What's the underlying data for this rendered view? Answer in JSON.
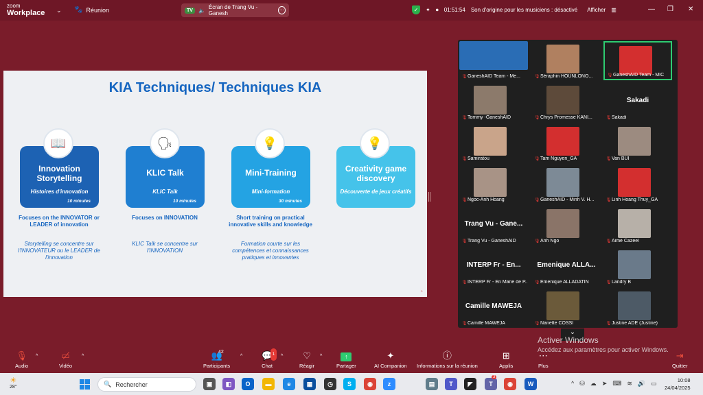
{
  "app": {
    "logo_line1": "zoom",
    "logo_line2": "Workplace",
    "meeting_label": "Réunion"
  },
  "share_pill": {
    "badge": "TV",
    "text": "Écran de Trang Vu - Ganesh"
  },
  "topbar": {
    "timer": "01:51:54",
    "audio_status": "Son d'origine pour les musiciens : désactivé",
    "view_label": "Afficher"
  },
  "slide": {
    "title": "KIA Techniques/ Techniques KIA",
    "cards": [
      {
        "title": "Innovation Storytelling",
        "subtitle": "Histoires d'innovation",
        "duration": "10 minutes",
        "desc_en": "Focuses on the INNOVATOR or LEADER of innovation",
        "desc_fr": "Storytelling se concentre sur l'INNOVATEUR ou le LEADER de l'innovation",
        "icon": "book-icon",
        "color": "#1d62b3"
      },
      {
        "title": "KLIC Talk",
        "subtitle": "KLIC Talk",
        "duration": "10 minutes",
        "desc_en": "Focuses on INNOVATION",
        "desc_fr": "KLIC Talk se concentre sur l'INNOVATION",
        "icon": "speaker-head-icon",
        "color": "#1f7fd1"
      },
      {
        "title": "Mini-Training",
        "subtitle": "Mini-formation",
        "duration": "30 minutes",
        "desc_en": "Short training on practical innovative skills and knowledge",
        "desc_fr": "Formation courte sur les compétences et connaissances pratiques et innovantes",
        "icon": "team-idea-icon",
        "color": "#24a3e3"
      },
      {
        "title": "Creativity game discovery",
        "subtitle": "Découverte de jeux créatifs",
        "duration": "",
        "desc_en": "",
        "desc_fr": "",
        "icon": "lightbulb-icon",
        "color": "#45c3ea"
      }
    ]
  },
  "gallery": {
    "tiles": [
      {
        "name": "GaneshAID Team - Me...",
        "kind": "video",
        "color": "#2a6db5",
        "big": ""
      },
      {
        "name": "Séraphin HOUNLONO...",
        "kind": "video",
        "color": "#b08060",
        "big": ""
      },
      {
        "name": "GaneshAID Team - MIC",
        "kind": "video",
        "color": "#d32f2f",
        "big": ""
      },
      {
        "name": "Tommy -GaneshAID",
        "kind": "video",
        "color": "#8c7a6b",
        "big": ""
      },
      {
        "name": "Chrys Promesse KANI...",
        "kind": "video",
        "color": "#5d4a3a",
        "big": ""
      },
      {
        "name": "Sakadi",
        "kind": "text",
        "color": "",
        "big": "Sakadi"
      },
      {
        "name": "Samiratou",
        "kind": "video",
        "color": "#c9a48a",
        "big": ""
      },
      {
        "name": "Tam Nguyen_GA",
        "kind": "video",
        "color": "#d32f2f",
        "big": ""
      },
      {
        "name": "Van BUI",
        "kind": "video",
        "color": "#9c8b80",
        "big": ""
      },
      {
        "name": "Ngoc-Anh Hoang",
        "kind": "video",
        "color": "#a89386",
        "big": ""
      },
      {
        "name": "GaneshAID - Minh V. H...",
        "kind": "video",
        "color": "#7d8a96",
        "big": ""
      },
      {
        "name": "Linh Hoang Thuy_GA",
        "kind": "video",
        "color": "#d32f2f",
        "big": ""
      },
      {
        "name": "Trang Vu - GaneshAID",
        "kind": "text",
        "color": "",
        "big": "Trang Vu - Gane..."
      },
      {
        "name": "Anh Ngo",
        "kind": "video",
        "color": "#8a7468",
        "big": ""
      },
      {
        "name": "Aimé Cazeel",
        "kind": "video",
        "color": "#b7b0a8",
        "big": ""
      },
      {
        "name": "INTERP Fr - En Marie de P...",
        "kind": "text",
        "color": "",
        "big": "INTERP Fr - En..."
      },
      {
        "name": "Emenique ALLADATIN",
        "kind": "text",
        "color": "",
        "big": "Emenique ALLA..."
      },
      {
        "name": "Landry B",
        "kind": "video",
        "color": "#6a7a8a",
        "big": ""
      },
      {
        "name": "Camille MAWEJA",
        "kind": "text",
        "color": "",
        "big": "Camille MAWEJA"
      },
      {
        "name": "Nanette COSSI",
        "kind": "video",
        "color": "#6b5a3a",
        "big": ""
      },
      {
        "name": "Justine ADE (Justine)",
        "kind": "video",
        "color": "#4d5a66",
        "big": ""
      }
    ]
  },
  "activate": {
    "line1": "Activer Windows",
    "line2": "Accédez aux paramètres pour activer Windows."
  },
  "controls": {
    "audio": "Audio",
    "video": "Vidéo",
    "participants": "Participants",
    "participants_count": "42",
    "chat": "Chat",
    "chat_badge": "1",
    "react": "Réagir",
    "share": "Partager",
    "ai": "AI Companion",
    "info": "Informations sur la réunion",
    "apps": "Applis",
    "more": "Plus",
    "quit": "Quitter"
  },
  "taskbar": {
    "temp": "28°",
    "search_placeholder": "Rechercher",
    "time": "10:08",
    "date": "24/04/2025",
    "teams_badge": "3"
  }
}
